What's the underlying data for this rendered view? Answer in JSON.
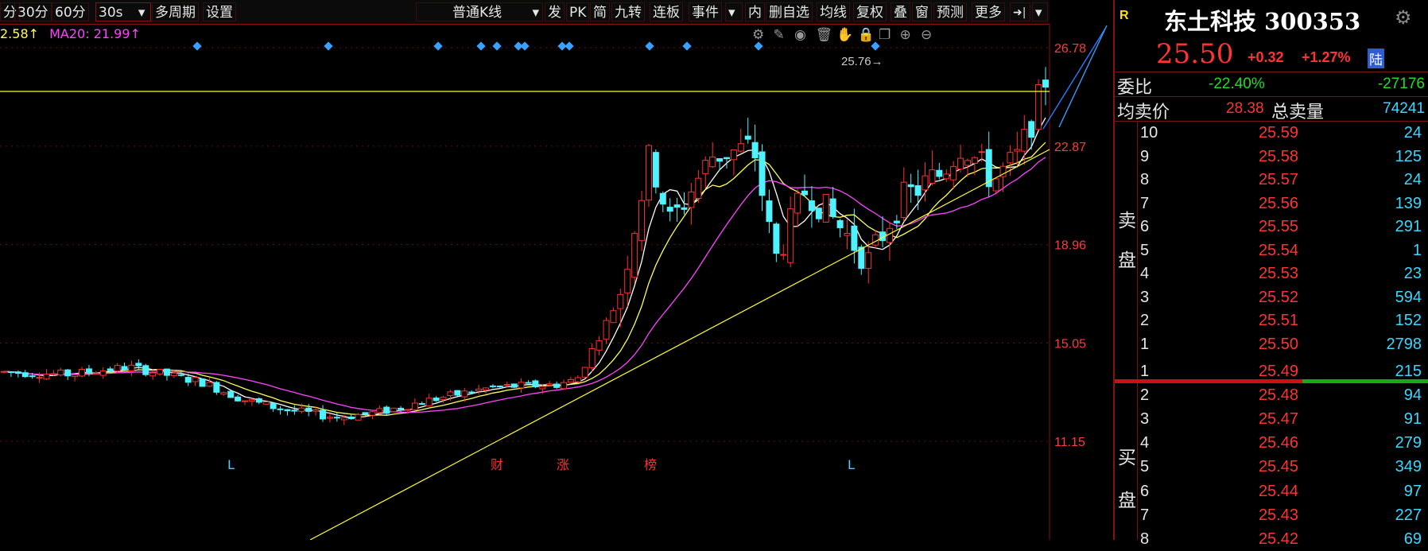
{
  "toolbar": {
    "left_items": [
      "分",
      "30分",
      "60分",
      "30s",
      "多周期",
      "设置"
    ],
    "chart_type": "普通K线",
    "right_items": [
      "发",
      "PK",
      "简",
      "九转",
      "连板",
      "事件",
      "内",
      "删自选",
      "均线",
      "复权",
      "叠",
      "窗",
      "预测",
      "更多"
    ],
    "arrow_glyph": "▾",
    "pin_glyph": "➜|"
  },
  "legend": {
    "ma10": "2.58↑",
    "ma20": "MA20: 21.99↑",
    "ma10_color": "#ffff55",
    "ma20_color": "#ff44ff"
  },
  "price_axis": [
    "26.78",
    "22.87",
    "18.96",
    "15.05",
    "11.15"
  ],
  "last_price_marker": "25.76→",
  "event_labels": [
    "L",
    "财",
    "涨",
    "榜",
    "L"
  ],
  "colors": {
    "up": "#ff3030",
    "down": "#4ff3ff",
    "ma5": "#ffffff",
    "ma10": "#ffff55",
    "ma20": "#ff44ff",
    "trendline": "#ffff33",
    "grid": "#6b0a0a",
    "accent_red": "#ff3333",
    "accent_green": "#22dd22",
    "cyan": "#3ad7ff"
  },
  "stock": {
    "badge": "R",
    "name": "东土科技 300353",
    "price": "25.50",
    "change": "+0.32",
    "change_pct": "+1.27%",
    "market_tag": "陆"
  },
  "weibi": {
    "label": "委比",
    "pct": "-22.40%",
    "diff": "-27176"
  },
  "avg_sell": {
    "label": "均卖价",
    "price": "28.38",
    "total_label": "总卖量",
    "total": "74241"
  },
  "sell_label": [
    "卖",
    "盘"
  ],
  "buy_label": [
    "买",
    "盘"
  ],
  "sells": [
    {
      "level": "10",
      "price": "25.59",
      "vol": "24"
    },
    {
      "level": "9",
      "price": "25.58",
      "vol": "125"
    },
    {
      "level": "8",
      "price": "25.57",
      "vol": "24"
    },
    {
      "level": "7",
      "price": "25.56",
      "vol": "139"
    },
    {
      "level": "6",
      "price": "25.55",
      "vol": "291"
    },
    {
      "level": "5",
      "price": "25.54",
      "vol": "1"
    },
    {
      "level": "4",
      "price": "25.53",
      "vol": "23"
    },
    {
      "level": "3",
      "price": "25.52",
      "vol": "594"
    },
    {
      "level": "2",
      "price": "25.51",
      "vol": "152"
    },
    {
      "level": "1",
      "price": "25.50",
      "vol": "2798"
    }
  ],
  "buys": [
    {
      "level": "1",
      "price": "25.49",
      "vol": "215"
    },
    {
      "level": "2",
      "price": "25.48",
      "vol": "94"
    },
    {
      "level": "3",
      "price": "25.47",
      "vol": "91"
    },
    {
      "level": "4",
      "price": "25.46",
      "vol": "279"
    },
    {
      "level": "5",
      "price": "25.45",
      "vol": "349"
    },
    {
      "level": "6",
      "price": "25.44",
      "vol": "97"
    },
    {
      "level": "7",
      "price": "25.43",
      "vol": "227"
    },
    {
      "level": "8",
      "price": "25.42",
      "vol": "69"
    }
  ]
}
